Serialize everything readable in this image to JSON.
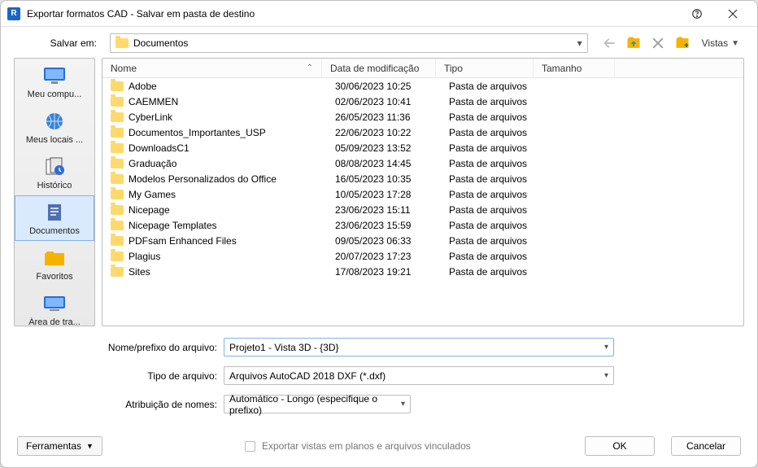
{
  "window": {
    "title": "Exportar formatos CAD - Salvar em pasta de destino"
  },
  "toprow": {
    "label": "Salvar em:",
    "location": "Documentos",
    "views_label": "Vistas"
  },
  "sidebar": {
    "items": [
      {
        "label": "Meu compu...",
        "icon": "monitor"
      },
      {
        "label": "Meus locais ...",
        "icon": "globe"
      },
      {
        "label": "Histórico",
        "icon": "history"
      },
      {
        "label": "Documentos",
        "icon": "doc",
        "selected": true
      },
      {
        "label": "Favoritos",
        "icon": "folder"
      },
      {
        "label": "Área de tra...",
        "icon": "desktop"
      }
    ]
  },
  "filelist": {
    "headers": {
      "name": "Nome",
      "date": "Data de modificação",
      "type": "Tipo",
      "size": "Tamanho"
    },
    "rows": [
      {
        "name": "Adobe",
        "date": "30/06/2023 10:25",
        "type": "Pasta de arquivos",
        "size": ""
      },
      {
        "name": "CAEMMEN",
        "date": "02/06/2023 10:41",
        "type": "Pasta de arquivos",
        "size": ""
      },
      {
        "name": "CyberLink",
        "date": "26/05/2023 11:36",
        "type": "Pasta de arquivos",
        "size": ""
      },
      {
        "name": "Documentos_Importantes_USP",
        "date": "22/06/2023 10:22",
        "type": "Pasta de arquivos",
        "size": ""
      },
      {
        "name": "DownloadsC1",
        "date": "05/09/2023 13:52",
        "type": "Pasta de arquivos",
        "size": ""
      },
      {
        "name": "Graduação",
        "date": "08/08/2023 14:45",
        "type": "Pasta de arquivos",
        "size": ""
      },
      {
        "name": "Modelos Personalizados do Office",
        "date": "16/05/2023 10:35",
        "type": "Pasta de arquivos",
        "size": ""
      },
      {
        "name": "My Games",
        "date": "10/05/2023 17:28",
        "type": "Pasta de arquivos",
        "size": ""
      },
      {
        "name": "Nicepage",
        "date": "23/06/2023 15:11",
        "type": "Pasta de arquivos",
        "size": ""
      },
      {
        "name": "Nicepage Templates",
        "date": "23/06/2023 15:59",
        "type": "Pasta de arquivos",
        "size": ""
      },
      {
        "name": "PDFsam Enhanced Files",
        "date": "09/05/2023 06:33",
        "type": "Pasta de arquivos",
        "size": ""
      },
      {
        "name": "Plagius",
        "date": "20/07/2023 17:23",
        "type": "Pasta de arquivos",
        "size": ""
      },
      {
        "name": "Sites",
        "date": "17/08/2023 19:21",
        "type": "Pasta de arquivos",
        "size": ""
      }
    ]
  },
  "form": {
    "filename_label": "Nome/prefixo do arquivo:",
    "filename_value": "Projeto1 - Vista 3D - {3D}",
    "filetype_label": "Tipo de arquivo:",
    "filetype_value": "Arquivos AutoCAD 2018 DXF  (*.dxf)",
    "naming_label": "Atribuição de nomes:",
    "naming_value": "Automático - Longo (especifique o prefixo)"
  },
  "bottom": {
    "tools_label": "Ferramentas",
    "checkbox_label": "Exportar vistas em planos e arquivos vinculados",
    "ok_label": "OK",
    "cancel_label": "Cancelar"
  }
}
